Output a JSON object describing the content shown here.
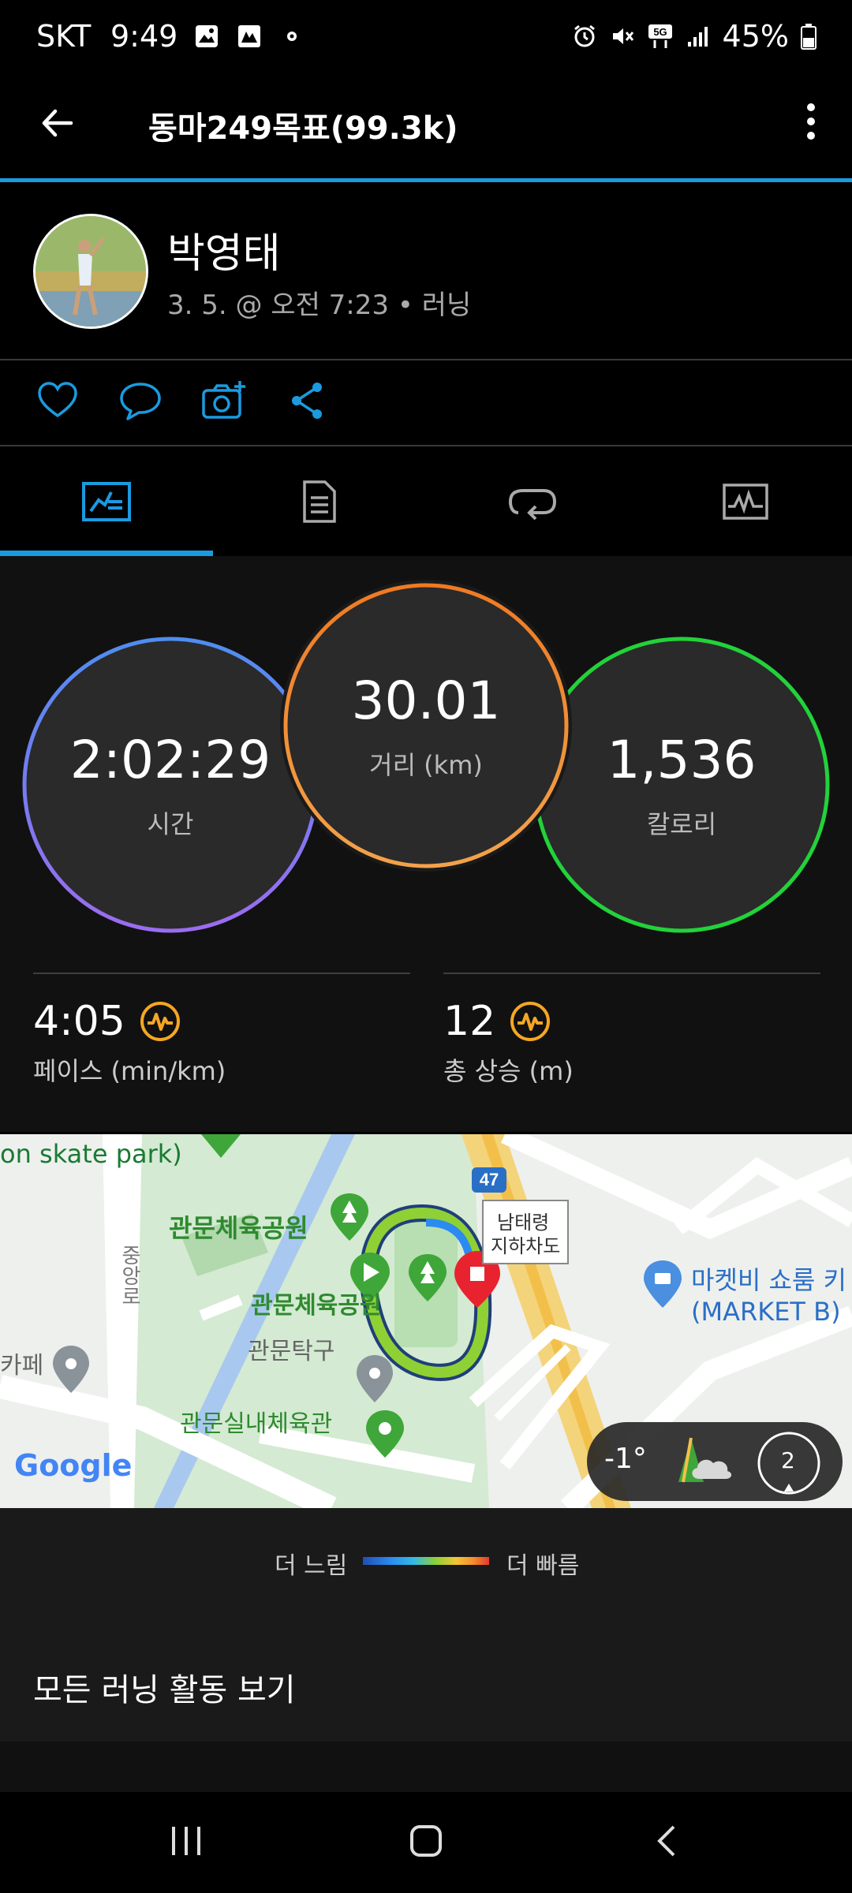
{
  "status_bar": {
    "carrier": "SKT",
    "time": "9:49",
    "battery": "45%",
    "network": "5G"
  },
  "app_bar": {
    "title": "동마249목표(99.3k)"
  },
  "activity": {
    "user_name": "박영태",
    "subtitle": "3. 5. @ 오전 7:23 • 러닝"
  },
  "tabs": [
    "stats-icon",
    "details-icon",
    "laps-icon",
    "chart-icon"
  ],
  "stats": {
    "time": {
      "value": "2:02:29",
      "label": "시간"
    },
    "distance": {
      "value": "30.01",
      "label": "거리 (km)"
    },
    "calories": {
      "value": "1,536",
      "label": "칼로리"
    },
    "pace": {
      "value": "4:05",
      "label": "페이스 (min/km)"
    },
    "elevation": {
      "value": "12",
      "label": "총 상승 (m)"
    }
  },
  "map": {
    "labels": {
      "skate": "on skate park)",
      "park1": "관문체육공원",
      "park2": "관문체육공원",
      "court": "관문탁구",
      "gym": "관문실내체육관",
      "cafe": "카페",
      "tunnel_1": "남태령",
      "tunnel_2": "지하차도",
      "market_1": "마켓비 쇼룸 키",
      "market_2": "(MARKET B)",
      "road": "중앙로",
      "route_no": "47",
      "google": "Google"
    },
    "weather": {
      "temp": "-1°",
      "wind": "2"
    }
  },
  "legend": {
    "slow": "더 느림",
    "fast": "더 빠름"
  },
  "view_all": "모든 러닝 활동 보기",
  "colors": {
    "accent": "#1a9be0",
    "time_ring": "#6a8cf0",
    "distance_ring": "#f08a2a",
    "calories_ring": "#22d23a",
    "route": "#8fd134"
  }
}
